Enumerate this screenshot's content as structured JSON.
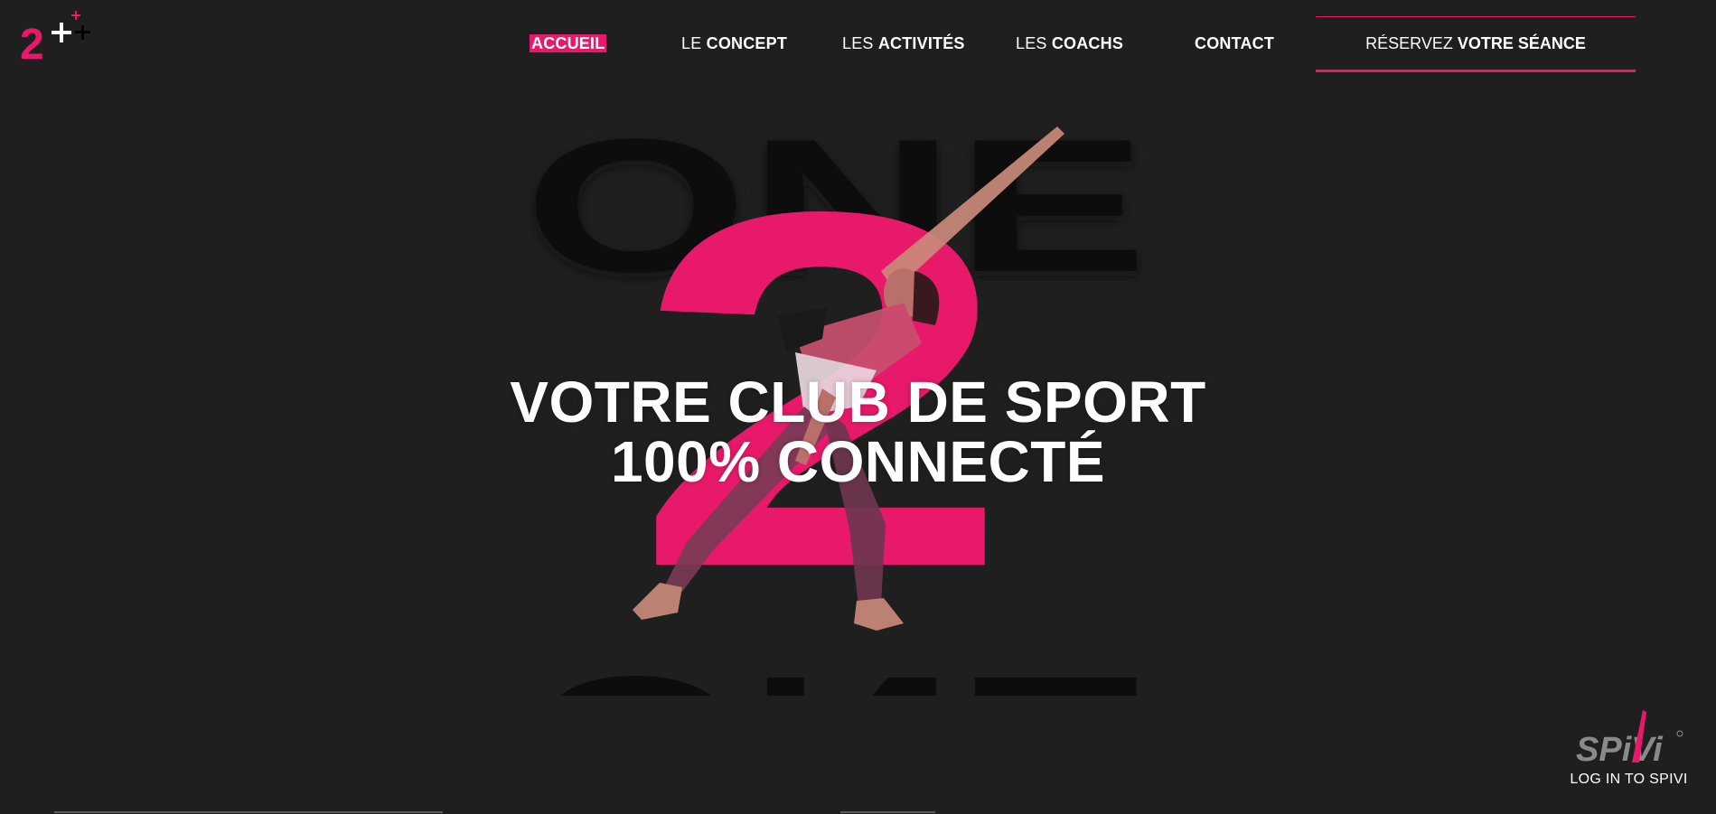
{
  "nav": {
    "items": [
      {
        "prefix": "",
        "label": "ACCUEIL",
        "active": true
      },
      {
        "prefix": "LE",
        "label": "CONCEPT"
      },
      {
        "prefix": "LES",
        "label": "ACTIVITÉS"
      },
      {
        "prefix": "LES",
        "label": "COACHS"
      },
      {
        "prefix": "",
        "label": "CONTACT"
      }
    ],
    "reserve": {
      "prefix": "RÉSERVEZ",
      "label": "VOTRE SÉANCE"
    }
  },
  "logo": {
    "glyph": "2",
    "plus": "+"
  },
  "hero": {
    "background_word": "ONE",
    "big_number": "2",
    "headline_line1": "VOTRE CLUB DE SPORT",
    "headline_line2": "100% CONNECTÉ"
  },
  "spivi": {
    "brand": "SPiVi",
    "label": "LOG IN TO SPIVI"
  },
  "colors": {
    "accent": "#e8196b",
    "background": "#1f1f1f",
    "text": "#ffffff"
  }
}
